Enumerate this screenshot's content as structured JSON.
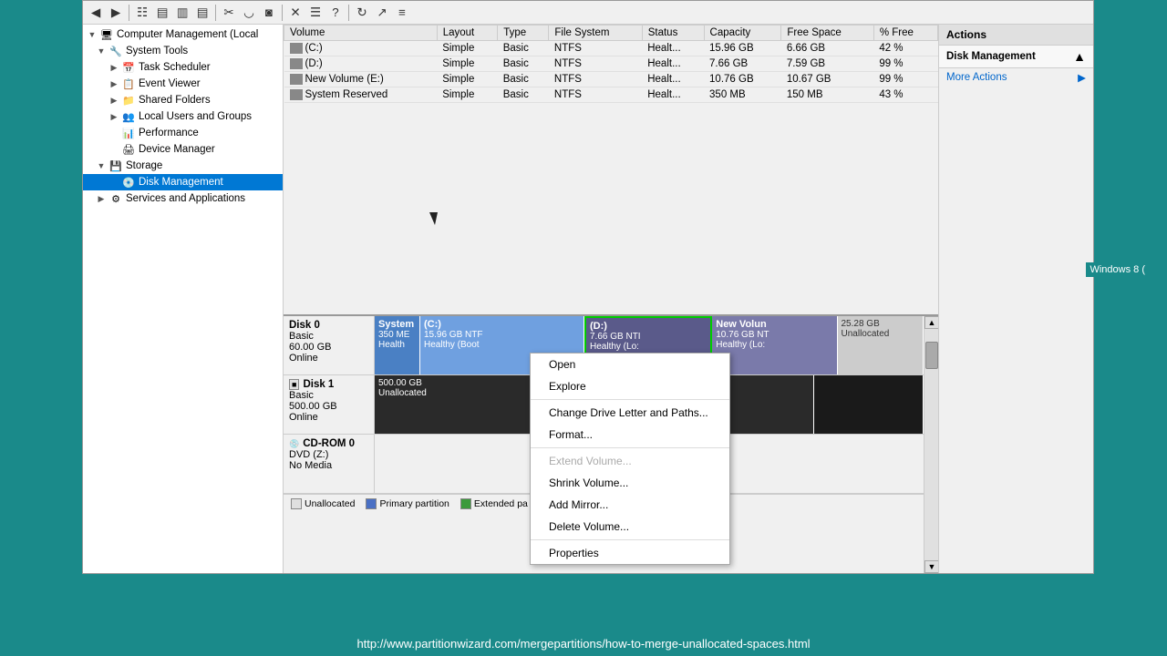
{
  "window": {
    "title": "Computer Management (Local",
    "actions_label": "Actions",
    "disk_management_label": "Disk Management",
    "more_actions_label": "More Actions"
  },
  "sidebar": {
    "root": "Computer Management (Local",
    "items": [
      {
        "id": "system-tools",
        "label": "System Tools",
        "level": 1,
        "expanded": true,
        "hasExpand": true
      },
      {
        "id": "task-scheduler",
        "label": "Task Scheduler",
        "level": 2,
        "expanded": false,
        "hasExpand": true
      },
      {
        "id": "event-viewer",
        "label": "Event Viewer",
        "level": 2,
        "expanded": false,
        "hasExpand": true
      },
      {
        "id": "shared-folders",
        "label": "Shared Folders",
        "level": 2,
        "expanded": false,
        "hasExpand": true
      },
      {
        "id": "local-users",
        "label": "Local Users and Groups",
        "level": 2,
        "expanded": false,
        "hasExpand": true
      },
      {
        "id": "performance",
        "label": "Performance",
        "level": 2,
        "expanded": false,
        "hasExpand": false
      },
      {
        "id": "device-manager",
        "label": "Device Manager",
        "level": 2,
        "expanded": false,
        "hasExpand": false
      },
      {
        "id": "storage",
        "label": "Storage",
        "level": 1,
        "expanded": true,
        "hasExpand": true
      },
      {
        "id": "disk-management",
        "label": "Disk Management",
        "level": 2,
        "expanded": false,
        "hasExpand": false,
        "selected": true
      },
      {
        "id": "services",
        "label": "Services and Applications",
        "level": 1,
        "expanded": false,
        "hasExpand": true
      }
    ]
  },
  "table": {
    "headers": [
      "Volume",
      "Layout",
      "Type",
      "File System",
      "Status",
      "Capacity",
      "Free Space",
      "% Free"
    ],
    "rows": [
      {
        "volume": "(C:)",
        "layout": "Simple",
        "type": "Basic",
        "fs": "NTFS",
        "status": "Healt...",
        "capacity": "15.96 GB",
        "free": "6.66 GB",
        "pct": "42 %"
      },
      {
        "volume": "(D:)",
        "layout": "Simple",
        "type": "Basic",
        "fs": "NTFS",
        "status": "Healt...",
        "capacity": "7.66 GB",
        "free": "7.59 GB",
        "pct": "99 %"
      },
      {
        "volume": "New Volume (E:)",
        "layout": "Simple",
        "type": "Basic",
        "fs": "NTFS",
        "status": "Healt...",
        "capacity": "10.76 GB",
        "free": "10.67 GB",
        "pct": "99 %"
      },
      {
        "volume": "System Reserved",
        "layout": "Simple",
        "type": "Basic",
        "fs": "NTFS",
        "status": "Healt...",
        "capacity": "350 MB",
        "free": "150 MB",
        "pct": "43 %"
      }
    ]
  },
  "disk0": {
    "name": "Disk 0",
    "type": "Basic",
    "size": "60.00 GB",
    "status": "Online",
    "partitions": [
      {
        "name": "System",
        "size": "350 ME",
        "detail": "Health",
        "style": "system"
      },
      {
        "name": "(C:)",
        "size": "15.96 GB NTF",
        "detail": "Healthy (Boot",
        "style": "c"
      },
      {
        "name": "(D:)",
        "size": "7.66 GB NTI",
        "detail": "Healthy (Lo:",
        "style": "d"
      },
      {
        "name": "New Volun",
        "size": "10.76 GB NT",
        "detail": "Healthy (Lo:",
        "style": "new"
      },
      {
        "name": "",
        "size": "25.28 GB",
        "detail": "Unallocated",
        "style": "unalloc"
      }
    ]
  },
  "disk1": {
    "name": "Disk 1",
    "type": "Basic",
    "size": "500.00 GB",
    "status": "Online",
    "partitions": [
      {
        "name": "",
        "size": "500.00 GB",
        "detail": "Unallocated",
        "style": "unalloc"
      }
    ]
  },
  "cdrom": {
    "name": "CD-ROM 0",
    "type": "DVD (Z:)",
    "status": "No Media"
  },
  "context_menu": {
    "items": [
      {
        "label": "Open",
        "disabled": false
      },
      {
        "label": "Explore",
        "disabled": false
      },
      {
        "label": "separator"
      },
      {
        "label": "Change Drive Letter and Paths...",
        "disabled": false
      },
      {
        "label": "Format...",
        "disabled": false
      },
      {
        "label": "separator"
      },
      {
        "label": "Extend Volume...",
        "disabled": true
      },
      {
        "label": "Shrink Volume...",
        "disabled": false
      },
      {
        "label": "Add Mirror...",
        "disabled": false
      },
      {
        "label": "Delete Volume...",
        "disabled": false
      },
      {
        "label": "separator"
      },
      {
        "label": "Properties",
        "disabled": false
      }
    ]
  },
  "legend": [
    {
      "color": "#e0e0e0",
      "label": "Unallocated"
    },
    {
      "color": "#5a7fd4",
      "label": "Primary partition"
    },
    {
      "color": "#4a9a4a",
      "label": "Extended pa"
    }
  ],
  "url": "http://www.partitionwizard.com/mergepartitions/how-to-merge-unallocated-spaces.html",
  "windows_badge": "Windows 8 (",
  "toolbar": {
    "icons": [
      "back",
      "forward",
      "up",
      "show-action-pane",
      "collapse-pane",
      "expand-pane",
      "refresh",
      "cut",
      "copy",
      "paste",
      "delete",
      "properties",
      "help"
    ]
  }
}
